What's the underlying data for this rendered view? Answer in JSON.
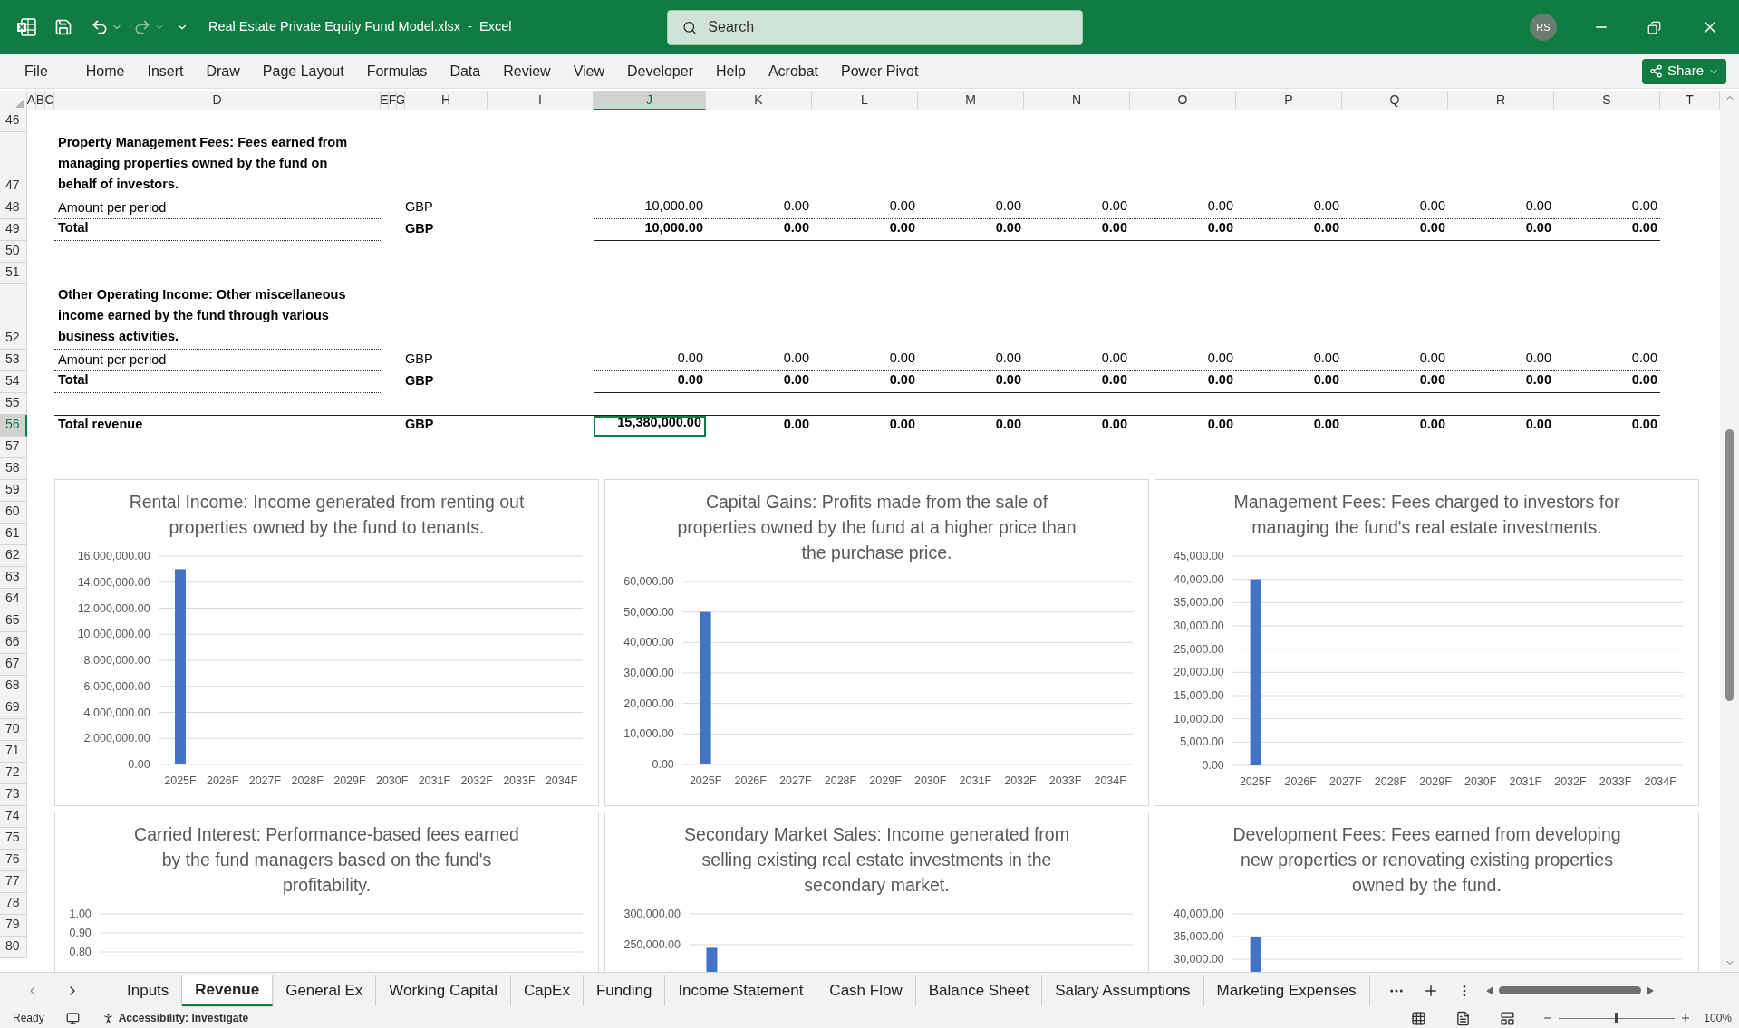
{
  "window": {
    "title": "Real Estate Private Equity Fund Model.xlsx  -  Excel"
  },
  "search": {
    "placeholder": "Search"
  },
  "account": {
    "initials": "RS"
  },
  "ribbon_tabs": [
    "File",
    "Home",
    "Insert",
    "Draw",
    "Page Layout",
    "Formulas",
    "Data",
    "Review",
    "View",
    "Developer",
    "Help",
    "Acrobat",
    "Power Pivot"
  ],
  "share": "Share",
  "columns": [
    {
      "label": "A",
      "selected": false
    },
    {
      "label": "B",
      "selected": false
    },
    {
      "label": "C",
      "selected": false
    },
    {
      "label": "D",
      "selected": false
    },
    {
      "label": "E",
      "selected": false
    },
    {
      "label": "F",
      "selected": false
    },
    {
      "label": "G",
      "selected": false
    },
    {
      "label": "H",
      "selected": false
    },
    {
      "label": "I",
      "selected": false
    },
    {
      "label": "J",
      "selected": true
    },
    {
      "label": "K",
      "selected": false
    },
    {
      "label": "L",
      "selected": false
    },
    {
      "label": "M",
      "selected": false
    },
    {
      "label": "N",
      "selected": false
    },
    {
      "label": "O",
      "selected": false
    },
    {
      "label": "P",
      "selected": false
    },
    {
      "label": "Q",
      "selected": false
    },
    {
      "label": "R",
      "selected": false
    },
    {
      "label": "S",
      "selected": false
    },
    {
      "label": "T",
      "selected": false
    }
  ],
  "rows": [
    {
      "number": "46",
      "kind": "blank",
      "selected": false
    },
    {
      "number": "47",
      "kind": "heading",
      "selected": false,
      "label": "Property Management Fees: Fees earned from managing properties owned by the fund on behalf of investors."
    },
    {
      "number": "48",
      "kind": "item",
      "selected": false,
      "label": "Amount per period",
      "unit": "GBP",
      "values": [
        "10,000.00",
        "0.00",
        "0.00",
        "0.00",
        "0.00",
        "0.00",
        "0.00",
        "0.00",
        "0.00",
        "0.00"
      ]
    },
    {
      "number": "49",
      "kind": "total",
      "selected": false,
      "label": "Total",
      "unit": "GBP",
      "values": [
        "10,000.00",
        "0.00",
        "0.00",
        "0.00",
        "0.00",
        "0.00",
        "0.00",
        "0.00",
        "0.00",
        "0.00"
      ]
    },
    {
      "number": "50",
      "kind": "blank",
      "selected": false
    },
    {
      "number": "51",
      "kind": "blank",
      "selected": false
    },
    {
      "number": "52",
      "kind": "heading",
      "selected": false,
      "label": "Other Operating Income: Other miscellaneous income earned by the fund through various business activities."
    },
    {
      "number": "53",
      "kind": "item",
      "selected": false,
      "label": "Amount per period",
      "unit": "GBP",
      "values": [
        "0.00",
        "0.00",
        "0.00",
        "0.00",
        "0.00",
        "0.00",
        "0.00",
        "0.00",
        "0.00",
        "0.00"
      ]
    },
    {
      "number": "54",
      "kind": "total",
      "selected": false,
      "label": "Total",
      "unit": "GBP",
      "values": [
        "0.00",
        "0.00",
        "0.00",
        "0.00",
        "0.00",
        "0.00",
        "0.00",
        "0.00",
        "0.00",
        "0.00"
      ]
    },
    {
      "number": "55",
      "kind": "blank",
      "selected": false
    },
    {
      "number": "56",
      "kind": "grand_total",
      "selected": true,
      "label": "Total revenue",
      "unit": "GBP",
      "values": [
        "15,380,000.00",
        "0.00",
        "0.00",
        "0.00",
        "0.00",
        "0.00",
        "0.00",
        "0.00",
        "0.00",
        "0.00"
      ]
    },
    {
      "number": "57",
      "kind": "blank",
      "selected": false
    },
    {
      "number": "58",
      "kind": "blank",
      "selected": false
    },
    {
      "number": "59",
      "kind": "blank",
      "selected": false
    },
    {
      "number": "60",
      "kind": "blank",
      "selected": false
    },
    {
      "number": "61",
      "kind": "blank",
      "selected": false
    },
    {
      "number": "62",
      "kind": "blank",
      "selected": false
    },
    {
      "number": "63",
      "kind": "blank",
      "selected": false
    },
    {
      "number": "64",
      "kind": "blank",
      "selected": false
    },
    {
      "number": "65",
      "kind": "blank",
      "selected": false
    },
    {
      "number": "66",
      "kind": "blank",
      "selected": false
    },
    {
      "number": "67",
      "kind": "blank",
      "selected": false
    },
    {
      "number": "68",
      "kind": "blank",
      "selected": false
    },
    {
      "number": "69",
      "kind": "blank",
      "selected": false
    },
    {
      "number": "70",
      "kind": "blank",
      "selected": false
    },
    {
      "number": "71",
      "kind": "blank",
      "selected": false
    },
    {
      "number": "72",
      "kind": "blank",
      "selected": false
    },
    {
      "number": "73",
      "kind": "blank",
      "selected": false
    },
    {
      "number": "74",
      "kind": "blank",
      "selected": false
    },
    {
      "number": "75",
      "kind": "blank",
      "selected": false
    },
    {
      "number": "76",
      "kind": "blank",
      "selected": false
    },
    {
      "number": "77",
      "kind": "blank",
      "selected": false
    },
    {
      "number": "78",
      "kind": "blank",
      "selected": false
    },
    {
      "number": "79",
      "kind": "blank",
      "selected": false
    },
    {
      "number": "80",
      "kind": "blank",
      "selected": false
    }
  ],
  "charts": [
    {
      "chart_data": {
        "type": "bar",
        "title": "Rental Income: Income generated from renting out properties owned by the fund to tenants.",
        "categories": [
          "2025F",
          "2026F",
          "2027F",
          "2028F",
          "2029F",
          "2030F",
          "2031F",
          "2032F",
          "2033F",
          "2034F"
        ],
        "grid": true,
        "series": [
          {
            "color": "#4472c4",
            "values": [
              15000000,
              0,
              0,
              0,
              0,
              0,
              0,
              0,
              0,
              0
            ]
          }
        ],
        "ylim": [
          0,
          16000000
        ],
        "yticks": [
          {
            "value": 0,
            "label": "0.00"
          },
          {
            "value": 2000000,
            "label": "2,000,000.00"
          },
          {
            "value": 4000000,
            "label": "4,000,000.00"
          },
          {
            "value": 6000000,
            "label": "6,000,000.00"
          },
          {
            "value": 8000000,
            "label": "8,000,000.00"
          },
          {
            "value": 10000000,
            "label": "10,000,000.00"
          },
          {
            "value": 12000000,
            "label": "12,000,000.00"
          },
          {
            "value": 14000000,
            "label": "14,000,000.00"
          },
          {
            "value": 16000000,
            "label": "16,000,000.00"
          }
        ]
      }
    },
    {
      "chart_data": {
        "type": "bar",
        "title": "Capital Gains: Profits made from the sale of properties owned by the fund at a higher price than the purchase price.",
        "categories": [
          "2025F",
          "2026F",
          "2027F",
          "2028F",
          "2029F",
          "2030F",
          "2031F",
          "2032F",
          "2033F",
          "2034F"
        ],
        "grid": true,
        "series": [
          {
            "color": "#4472c4",
            "values": [
              50000,
              0,
              0,
              0,
              0,
              0,
              0,
              0,
              0,
              0
            ]
          }
        ],
        "ylim": [
          0,
          60000
        ],
        "yticks": [
          {
            "value": 0,
            "label": "0.00"
          },
          {
            "value": 10000,
            "label": "10,000.00"
          },
          {
            "value": 20000,
            "label": "20,000.00"
          },
          {
            "value": 30000,
            "label": "30,000.00"
          },
          {
            "value": 40000,
            "label": "40,000.00"
          },
          {
            "value": 50000,
            "label": "50,000.00"
          },
          {
            "value": 60000,
            "label": "60,000.00"
          }
        ]
      }
    },
    {
      "chart_data": {
        "type": "bar",
        "title": "Management Fees: Fees charged to investors for managing the fund's real estate investments.",
        "categories": [
          "2025F",
          "2026F",
          "2027F",
          "2028F",
          "2029F",
          "2030F",
          "2031F",
          "2032F",
          "2033F",
          "2034F"
        ],
        "grid": true,
        "series": [
          {
            "color": "#4472c4",
            "values": [
              40000,
              0,
              0,
              0,
              0,
              0,
              0,
              0,
              0,
              0
            ]
          }
        ],
        "ylim": [
          0,
          45000
        ],
        "yticks": [
          {
            "value": 0,
            "label": "0.00"
          },
          {
            "value": 5000,
            "label": "5,000.00"
          },
          {
            "value": 10000,
            "label": "10,000.00"
          },
          {
            "value": 15000,
            "label": "15,000.00"
          },
          {
            "value": 20000,
            "label": "20,000.00"
          },
          {
            "value": 25000,
            "label": "25,000.00"
          },
          {
            "value": 30000,
            "label": "30,000.00"
          },
          {
            "value": 35000,
            "label": "35,000.00"
          },
          {
            "value": 40000,
            "label": "40,000.00"
          },
          {
            "value": 45000,
            "label": "45,000.00"
          }
        ]
      }
    },
    {
      "chart_data": {
        "type": "bar",
        "title": "Carried Interest: Performance-based fees earned by the fund managers based on the fund's profitability.",
        "categories": [
          null,
          null,
          null,
          null,
          null,
          null,
          null,
          null,
          null,
          null
        ],
        "grid": true,
        "ylim": [
          0.8,
          1
        ],
        "yticks": [
          {
            "value": 0.8,
            "label": "0.80"
          },
          {
            "value": 0.9,
            "label": "0.90"
          },
          {
            "value": 1,
            "label": "1.00"
          }
        ]
      }
    },
    {
      "chart_data": {
        "type": "bar",
        "title": "Secondary Market Sales: Income generated from selling existing real estate investments in the secondary market.",
        "grid": true,
        "series": [
          {
            "color": "#4472c4",
            "values": [
              245000
            ]
          }
        ],
        "ylim": [
          0,
          300000
        ],
        "yticks": [
          {
            "value": 250000,
            "label": "250,000.00"
          },
          {
            "value": 300000,
            "label": "300,000.00"
          }
        ]
      }
    },
    {
      "chart_data": {
        "type": "bar",
        "title": "Development Fees: Fees earned from developing new properties or renovating existing properties owned by the fund.",
        "grid": true,
        "series": [
          {
            "color": "#4472c4",
            "values": [
              35000
            ]
          }
        ],
        "ylim": [
          0,
          40000
        ],
        "yticks": [
          {
            "value": 30000,
            "label": "30,000.00"
          },
          {
            "value": 35000,
            "label": "35,000.00"
          },
          {
            "value": 40000,
            "label": "40,000.00"
          }
        ]
      }
    }
  ],
  "sheet_tabs": [
    {
      "label": "Inputs",
      "selected": false
    },
    {
      "label": "Revenue",
      "selected": true
    },
    {
      "label": "General Ex",
      "selected": false
    },
    {
      "label": "Working Capital",
      "selected": false
    },
    {
      "label": "CapEx",
      "selected": false
    },
    {
      "label": "Funding",
      "selected": false
    },
    {
      "label": "Income Statement",
      "selected": false
    },
    {
      "label": "Cash Flow",
      "selected": false
    },
    {
      "label": "Balance Sheet",
      "selected": false
    },
    {
      "label": "Salary Assumptions",
      "selected": false
    },
    {
      "label": "Marketing Expenses",
      "selected": false
    }
  ],
  "status_bar": {
    "mode": "Ready",
    "accessibility": "Accessibility: Investigate",
    "zoom": "100%",
    "zoom_slider": {
      "level": 0.5
    }
  }
}
